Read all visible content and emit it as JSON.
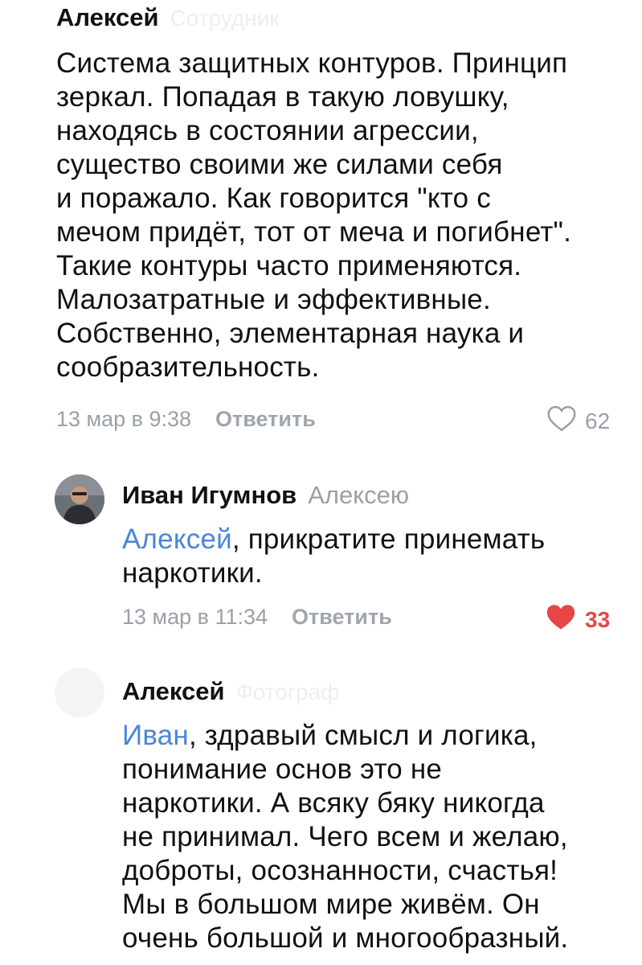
{
  "comments": [
    {
      "author": "Алексей",
      "faded_label": "Сотрудник",
      "text_lines": [
        "Система защитных контуров. Принцип",
        "зеркал. Попадая в такую ловушку,",
        "находясь в состоянии агрессии,",
        "существо своими же силами себя",
        "и поражало. Как говорится \"кто с",
        "мечом придёт, тот от меча и погибнет\".",
        "Такие контуры часто применяются.",
        "Малозатратные и эффективные.",
        "Собственно, элементарная наука и",
        "сообразительность."
      ],
      "date": "13 мар в 9:38",
      "reply_label": "Ответить",
      "likes": "62",
      "liked": false
    },
    {
      "author": "Иван Игумнов",
      "reply_to": "Алексею",
      "mention": "Алексей",
      "text_rest_line1": ", прикратите принемать",
      "text_lines": [
        "наркотики."
      ],
      "date": "13 мар в 11:34",
      "reply_label": "Ответить",
      "likes": "33",
      "liked": true,
      "colors": {
        "like": "#e64646"
      }
    },
    {
      "author": "Алексей",
      "faded_label": "Фотограф",
      "mention": "Иван",
      "text_rest_line1": ", здравый смысл и логика,",
      "text_lines": [
        "понимание основ это не",
        "наркотики. А всяку бяку никогда",
        "не принимал. Чего всем и желаю,",
        "доброты, осознанности, счастья!",
        "Мы в большом мире живём. Он",
        "очень большой и многообразный."
      ]
    }
  ],
  "colors": {
    "mention": "#4a86d8",
    "meta": "#9aa0a8",
    "text": "#111111"
  },
  "icons": {
    "like_empty": "heart-outline-icon",
    "like_filled": "heart-filled-icon"
  }
}
